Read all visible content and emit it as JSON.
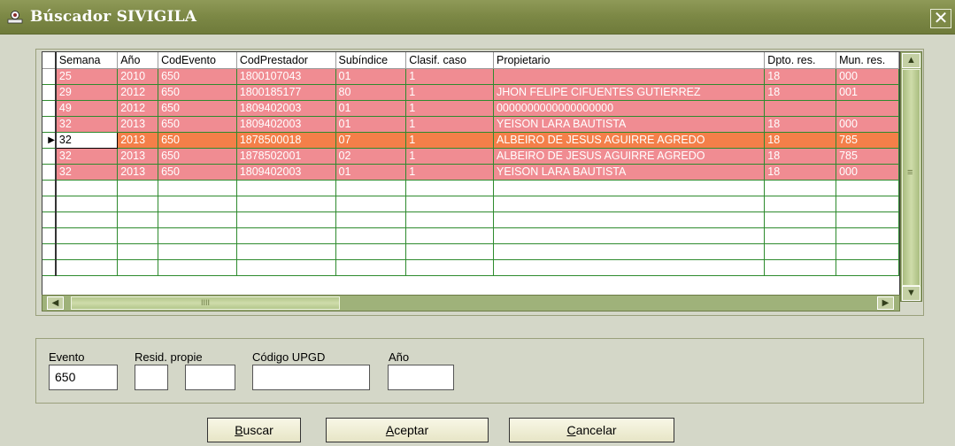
{
  "window": {
    "title": "Búscador SIVIGILA",
    "close_glyph": "✕",
    "icon": "search-person-icon"
  },
  "grid": {
    "columns": [
      "Semana",
      "Año",
      "CodEvento",
      "CodPrestador",
      "Subíndice",
      "Clasif. caso",
      "Propietario",
      "Dpto. res.",
      "Mun. res."
    ],
    "rows": [
      {
        "style": "pink",
        "cells": [
          "25",
          "2010",
          "650",
          "1800107043",
          "01",
          "1",
          "",
          "18",
          "000"
        ]
      },
      {
        "style": "pink",
        "cells": [
          "29",
          "2012",
          "650",
          "1800185177",
          "80",
          "1",
          "JHON FELIPE CIFUENTES GUTIERREZ",
          "18",
          "001"
        ]
      },
      {
        "style": "pink",
        "cells": [
          "49",
          "2012",
          "650",
          "1809402003",
          "01",
          "1",
          "0000000000000000000",
          "",
          ""
        ]
      },
      {
        "style": "pink",
        "cells": [
          "32",
          "2013",
          "650",
          "1809402003",
          "01",
          "1",
          "YEISON LARA BAUTISTA",
          "18",
          "000"
        ]
      },
      {
        "style": "orange",
        "current": true,
        "cells": [
          "32",
          "2013",
          "650",
          "1878500018",
          "07",
          "1",
          "ALBEIRO DE JESUS AGUIRRE AGREDO",
          "18",
          "785"
        ]
      },
      {
        "style": "pink",
        "cells": [
          "32",
          "2013",
          "650",
          "1878502001",
          "02",
          "1",
          "ALBEIRO DE JESUS AGUIRRE AGREDO",
          "18",
          "785"
        ]
      },
      {
        "style": "pink",
        "cells": [
          "32",
          "2013",
          "650",
          "1809402003",
          "01",
          "1",
          "YEISON LARA BAUTISTA",
          "18",
          "000"
        ]
      }
    ],
    "empty_rows": 6,
    "current_row_marker": "▶",
    "colors": {
      "row_pink": "#f08c92",
      "row_orange": "#f47f49",
      "grid_line": "#2e8b2e"
    }
  },
  "scrollbars": {
    "up": "▲",
    "down": "▼",
    "left": "◀",
    "right": "▶",
    "thumb_grip": "IIII",
    "v_grip": "≡"
  },
  "form": {
    "evento_label": "Evento",
    "evento_value": "650",
    "resid_label": "Resid. propie",
    "resid_value_1": "",
    "resid_value_2": "",
    "upgd_label": "Código UPGD",
    "upgd_value": "",
    "anio_label": "Año",
    "anio_value": ""
  },
  "buttons": {
    "buscar_mnemonic": "B",
    "buscar_rest": "uscar",
    "aceptar_mnemonic": "A",
    "aceptar_rest": "ceptar",
    "cancelar_mnemonic": "C",
    "cancelar_rest": "ancelar"
  }
}
